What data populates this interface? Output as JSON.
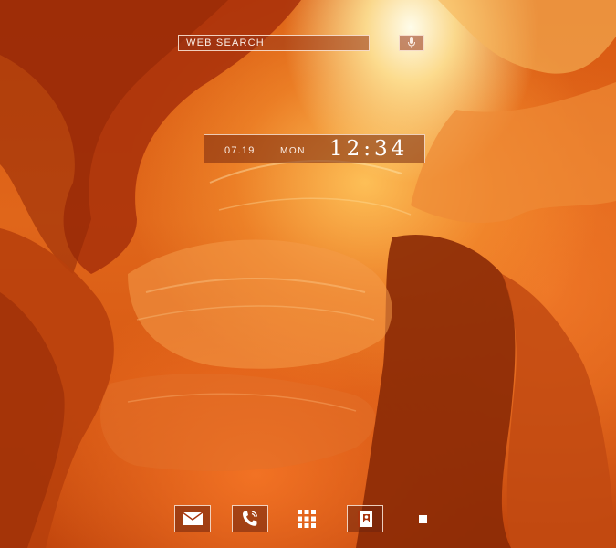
{
  "search": {
    "label": "WEB SEARCH"
  },
  "clock": {
    "date": "07.19",
    "day": "MON",
    "time": "12:34"
  },
  "dock": {
    "items": [
      {
        "name": "mail",
        "icon": "mail-icon"
      },
      {
        "name": "phone",
        "icon": "phone-icon"
      },
      {
        "name": "apps",
        "icon": "apps-grid-icon"
      },
      {
        "name": "contacts",
        "icon": "contacts-book-icon"
      }
    ]
  },
  "wallpaper": {
    "subject": "canyon",
    "colors": [
      "#b03a08",
      "#e0661a",
      "#ffd27a",
      "#fff6da"
    ]
  }
}
